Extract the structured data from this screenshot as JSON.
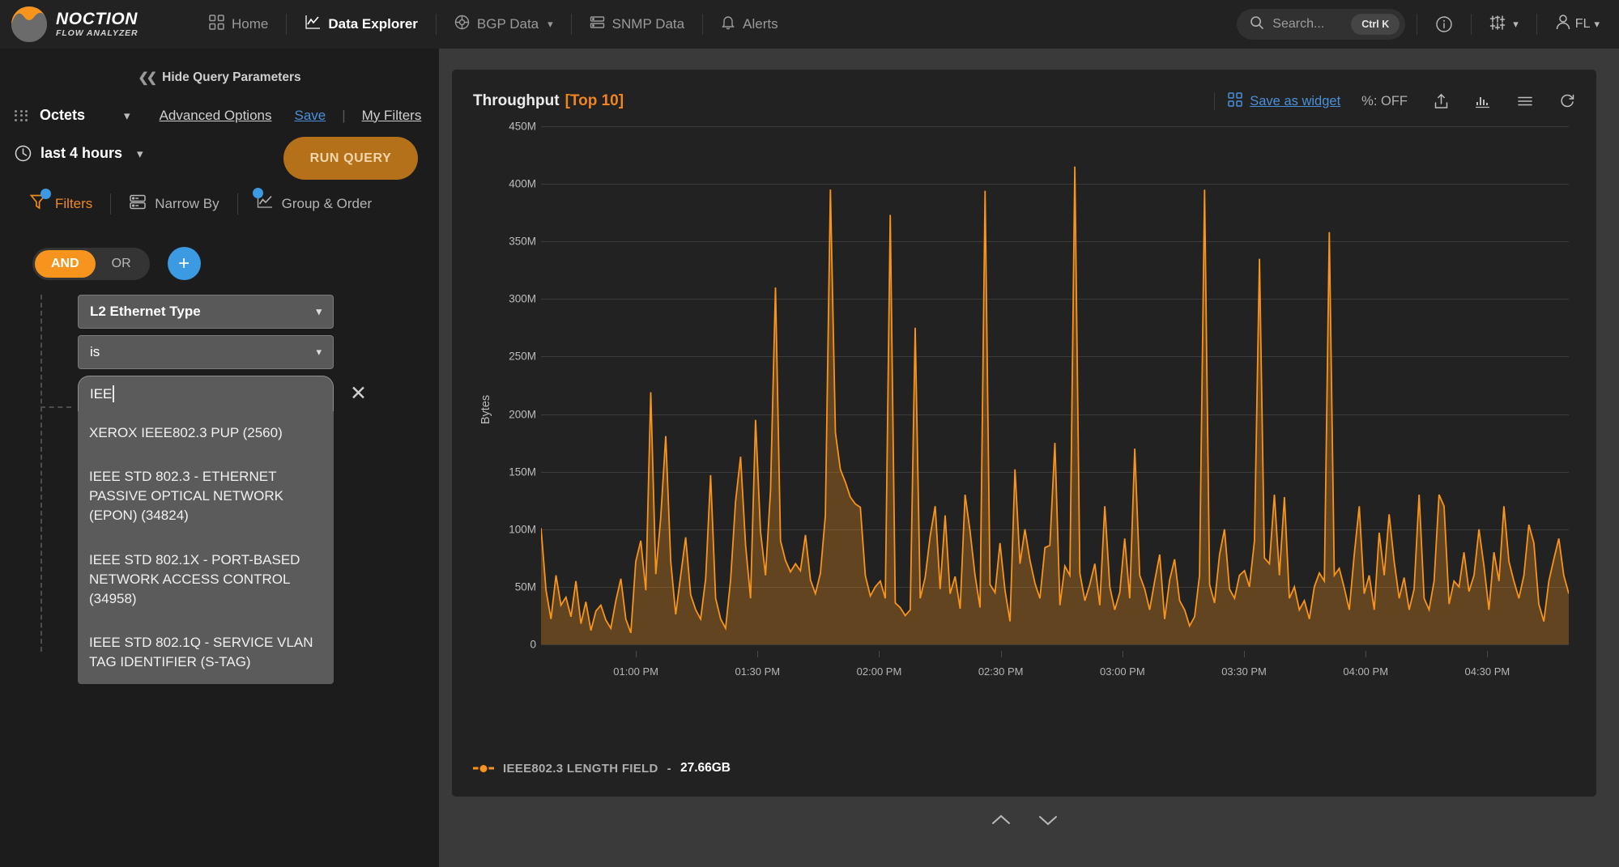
{
  "header": {
    "brand": {
      "title": "NOCTION",
      "subtitle": "FLOW ANALYZER",
      "logo_icon": "noction-wave-logo"
    },
    "nav": [
      {
        "label": "Home",
        "icon": "grid-icon",
        "active": false,
        "has_caret": false
      },
      {
        "label": "Data Explorer",
        "icon": "line-chart-icon",
        "active": true,
        "has_caret": false
      },
      {
        "label": "BGP Data",
        "icon": "globe-icon",
        "active": false,
        "has_caret": true
      },
      {
        "label": "SNMP Data",
        "icon": "server-icon",
        "active": false,
        "has_caret": false
      },
      {
        "label": "Alerts",
        "icon": "bell-icon",
        "active": false,
        "has_caret": false
      }
    ],
    "search": {
      "placeholder": "Search...",
      "shortcut": "Ctrl K",
      "icon": "search-icon"
    },
    "info_icon": "info-circle-icon",
    "settings_icon": "sliders-icon",
    "user": {
      "label": "FL",
      "icon": "user-icon"
    }
  },
  "sidebar": {
    "hide_params_label": "Hide Query Parameters",
    "hide_params_icon": "double-chevron-left-icon",
    "metric": {
      "grip_icon": "drag-grip-icon",
      "value": "Octets",
      "caret_icon": "chevron-down-icon"
    },
    "advanced_options_label": "Advanced Options",
    "save_label": "Save",
    "my_filters_label": "My Filters",
    "time_range": {
      "icon": "clock-icon",
      "value": "last 4 hours",
      "caret_icon": "chevron-down-icon"
    },
    "run_query_label": "RUN QUERY",
    "tabs": [
      {
        "label": "Filters",
        "icon": "funnel-icon",
        "active": true,
        "badge": true
      },
      {
        "label": "Narrow By",
        "icon": "stacked-rows-icon",
        "active": false,
        "badge": false
      },
      {
        "label": "Group & Order",
        "icon": "line-chart-icon",
        "active": false,
        "badge": true
      }
    ],
    "logic": {
      "and_label": "AND",
      "or_label": "OR",
      "selected": "AND",
      "add_icon": "plus-icon"
    },
    "filter": {
      "field": "L2 Ethernet Type",
      "operator": "is",
      "value_input": "IEE",
      "remove_icon": "close-icon",
      "suggestions": [
        "XEROX IEEE802.3 PUP (2560)",
        "IEEE STD 802.3 - ETHERNET PASSIVE OPTICAL NETWORK (EPON) (34824)",
        "IEEE STD 802.1X - PORT-BASED NETWORK ACCESS CONTROL (34958)",
        "IEEE STD 802.1Q - SERVICE VLAN TAG IDENTIFIER (S-TAG)"
      ]
    }
  },
  "chart_panel": {
    "title": "Throughput",
    "title_badge": "[Top 10]",
    "save_as_widget_label": "Save as widget",
    "save_as_widget_icon": "widget-grid-icon",
    "percent_label": "%: OFF",
    "tools": [
      {
        "name": "export-icon"
      },
      {
        "name": "bar-chart-icon"
      },
      {
        "name": "hamburger-menu-icon"
      },
      {
        "name": "refresh-icon"
      }
    ],
    "pager": {
      "up_icon": "chevron-up-icon",
      "down_icon": "chevron-down-icon"
    },
    "accent_color": "#f7941d",
    "link_color": "#4a90d9"
  },
  "chart_data": {
    "type": "area",
    "title": "Throughput [Top 10]",
    "xlabel": "",
    "ylabel": "Bytes",
    "ylim": [
      0,
      450000000
    ],
    "yticks": [
      0,
      50000000,
      100000000,
      150000000,
      200000000,
      250000000,
      300000000,
      350000000,
      400000000,
      450000000
    ],
    "ytick_labels": [
      "0",
      "50M",
      "100M",
      "150M",
      "200M",
      "250M",
      "300M",
      "350M",
      "400M",
      "450M"
    ],
    "xtick_labels": [
      "01:00 PM",
      "01:30 PM",
      "02:00 PM",
      "02:30 PM",
      "03:00 PM",
      "03:30 PM",
      "04:00 PM",
      "04:30 PM"
    ],
    "grid": true,
    "legend_position": "bottom-left",
    "series": [
      {
        "name": "IEEE802.3 LENGTH FIELD",
        "total": "27.66GB",
        "color": "#f7941d",
        "values": [
          101,
          47,
          22,
          60,
          34,
          41,
          24,
          55,
          18,
          37,
          12,
          29,
          34,
          21,
          14,
          38,
          57,
          22,
          10,
          72,
          90,
          47,
          219,
          61,
          110,
          181,
          72,
          26,
          60,
          93,
          43,
          30,
          22,
          57,
          147,
          40,
          22,
          14,
          56,
          124,
          163,
          86,
          40,
          195,
          98,
          60,
          134,
          310,
          90,
          73,
          63,
          70,
          64,
          95,
          56,
          44,
          62,
          112,
          395,
          184,
          152,
          141,
          128,
          122,
          119,
          60,
          42,
          50,
          55,
          40,
          373,
          36,
          32,
          25,
          30,
          275,
          40,
          58,
          94,
          120,
          48,
          112,
          44,
          59,
          31,
          130,
          98,
          60,
          32,
          394,
          52,
          45,
          88,
          47,
          20,
          152,
          70,
          100,
          73,
          53,
          40,
          84,
          86,
          175,
          34,
          68,
          60,
          415,
          62,
          38,
          52,
          70,
          34,
          120,
          50,
          30,
          45,
          92,
          40,
          170,
          60,
          48,
          30,
          55,
          78,
          22,
          56,
          74,
          38,
          30,
          16,
          24,
          60,
          395,
          52,
          36,
          78,
          100,
          48,
          40,
          60,
          64,
          50,
          90,
          335,
          75,
          70,
          130,
          60,
          128,
          40,
          50,
          30,
          38,
          22,
          50,
          62,
          55,
          358,
          60,
          66,
          49,
          30,
          78,
          120,
          44,
          60,
          30,
          97,
          60,
          113,
          72,
          40,
          58,
          30,
          48,
          130,
          40,
          30,
          55,
          130,
          120,
          35,
          55,
          50,
          80,
          46,
          60,
          100,
          68,
          30,
          80,
          55,
          120,
          72,
          55,
          40,
          60,
          104,
          88,
          35,
          20,
          55,
          74,
          92,
          60,
          44
        ],
        "units": "M"
      }
    ]
  }
}
